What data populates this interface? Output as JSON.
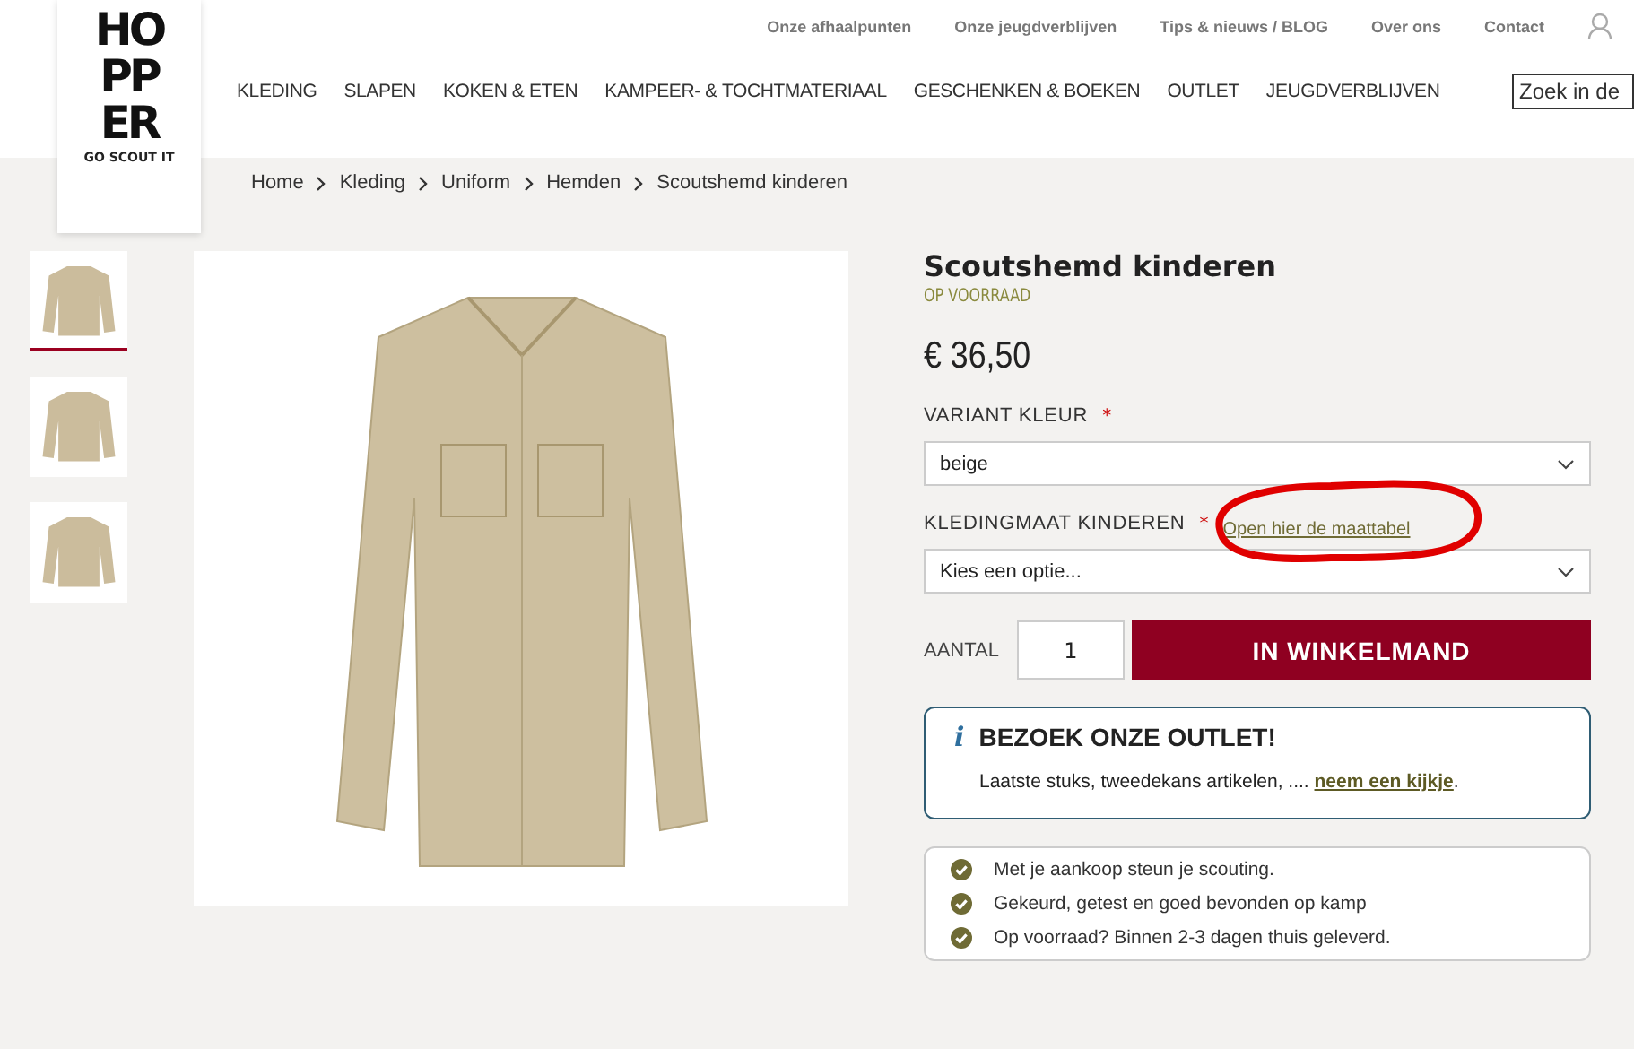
{
  "logo": {
    "lines": [
      "HO",
      "PP",
      "ER"
    ],
    "tagline": "GO SCOUT IT"
  },
  "top_links": [
    "Onze afhaalpunten",
    "Onze jeugdverblijven",
    "Tips & nieuws / BLOG",
    "Over ons",
    "Contact"
  ],
  "main_nav": [
    "KLEDING",
    "SLAPEN",
    "KOKEN & ETEN",
    "KAMPEER- & TOCHTMATERIAAL",
    "GESCHENKEN & BOEKEN",
    "OUTLET",
    "JEUGDVERBLIJVEN"
  ],
  "search": {
    "placeholder": "Zoek in de"
  },
  "breadcrumb": [
    "Home",
    "Kleding",
    "Uniform",
    "Hemden",
    "Scoutshemd kinderen"
  ],
  "thumbnails": [
    {
      "selected": true
    },
    {
      "selected": false
    },
    {
      "selected": false
    }
  ],
  "product": {
    "title": "Scoutshemd kinderen",
    "stock": "OP VOORRAAD",
    "price": "€ 36,50",
    "options": [
      {
        "label": "VARIANT KLEUR",
        "required_mark": "*",
        "value": "beige"
      },
      {
        "label": "KLEDINGMAAT KINDEREN",
        "required_mark": "*",
        "link": "Open hier de maattabel",
        "value": "Kies een optie...",
        "highlighted": true
      }
    ],
    "quantity_label": "AANTAL",
    "quantity": "1",
    "add_button": "IN WINKELMAND"
  },
  "outlet_box": {
    "icon": "i",
    "title": "BEZOEK ONZE OUTLET!",
    "text": "Laatste stuks, tweedekans artikelen, ....",
    "link": "neem een kijkje",
    "end": "."
  },
  "usps": [
    "Met je aankoop steun je scouting.",
    "Gekeurd, getest en goed bevonden op kamp",
    "Op voorraad? Binnen 2-3 dagen thuis geleverd."
  ]
}
